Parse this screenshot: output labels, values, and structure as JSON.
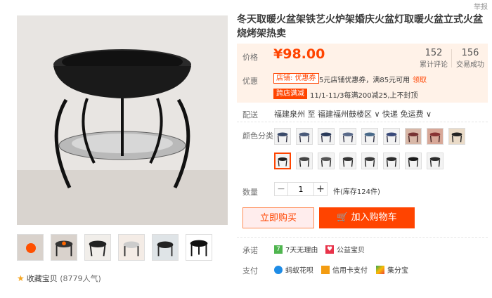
{
  "header": {
    "report": "举报"
  },
  "product": {
    "title": "冬天取暖火盆架铁艺火炉架婚庆火盆灯取暖火盆立式火盆烧烤架热卖",
    "price_label": "价格",
    "price": "¥98.00",
    "reviews_count": "152",
    "reviews_label": "累计评论",
    "sales_count": "156",
    "sales_label": "交易成功"
  },
  "promo": {
    "label": "优惠",
    "tag1": "店铺: 优惠券",
    "text1": "5元店铺优惠券，满85元可用",
    "claim": "领取",
    "tag2": "跨店满减",
    "text2": "11/1-11/3每满200减25,上不封顶"
  },
  "shipping": {
    "label": "配送",
    "text": "福建泉州 至  福建福州鼓楼区  ∨  快递 免运费  ∨"
  },
  "color": {
    "label": "颜色分类"
  },
  "quantity": {
    "label": "数量",
    "minus": "−",
    "value": "1",
    "plus": "+",
    "stock": "件(库存124件)"
  },
  "buttons": {
    "buy": "立即购买",
    "cart": "加入购物车"
  },
  "promise": {
    "label": "承诺",
    "item1": "7天无理由",
    "item2": "公益宝贝"
  },
  "payment": {
    "label": "支付",
    "item1": "蚂蚁花呗",
    "item2": "信用卡支付",
    "item3": "集分宝"
  },
  "favorite": {
    "text": "收藏宝贝",
    "popularity": "(8779人气)"
  },
  "icons": [
    "cart-icon",
    "star-icon",
    "play-icon"
  ],
  "colors": {
    "accent": "#ff4400",
    "price_bg": "#fff2e8"
  }
}
